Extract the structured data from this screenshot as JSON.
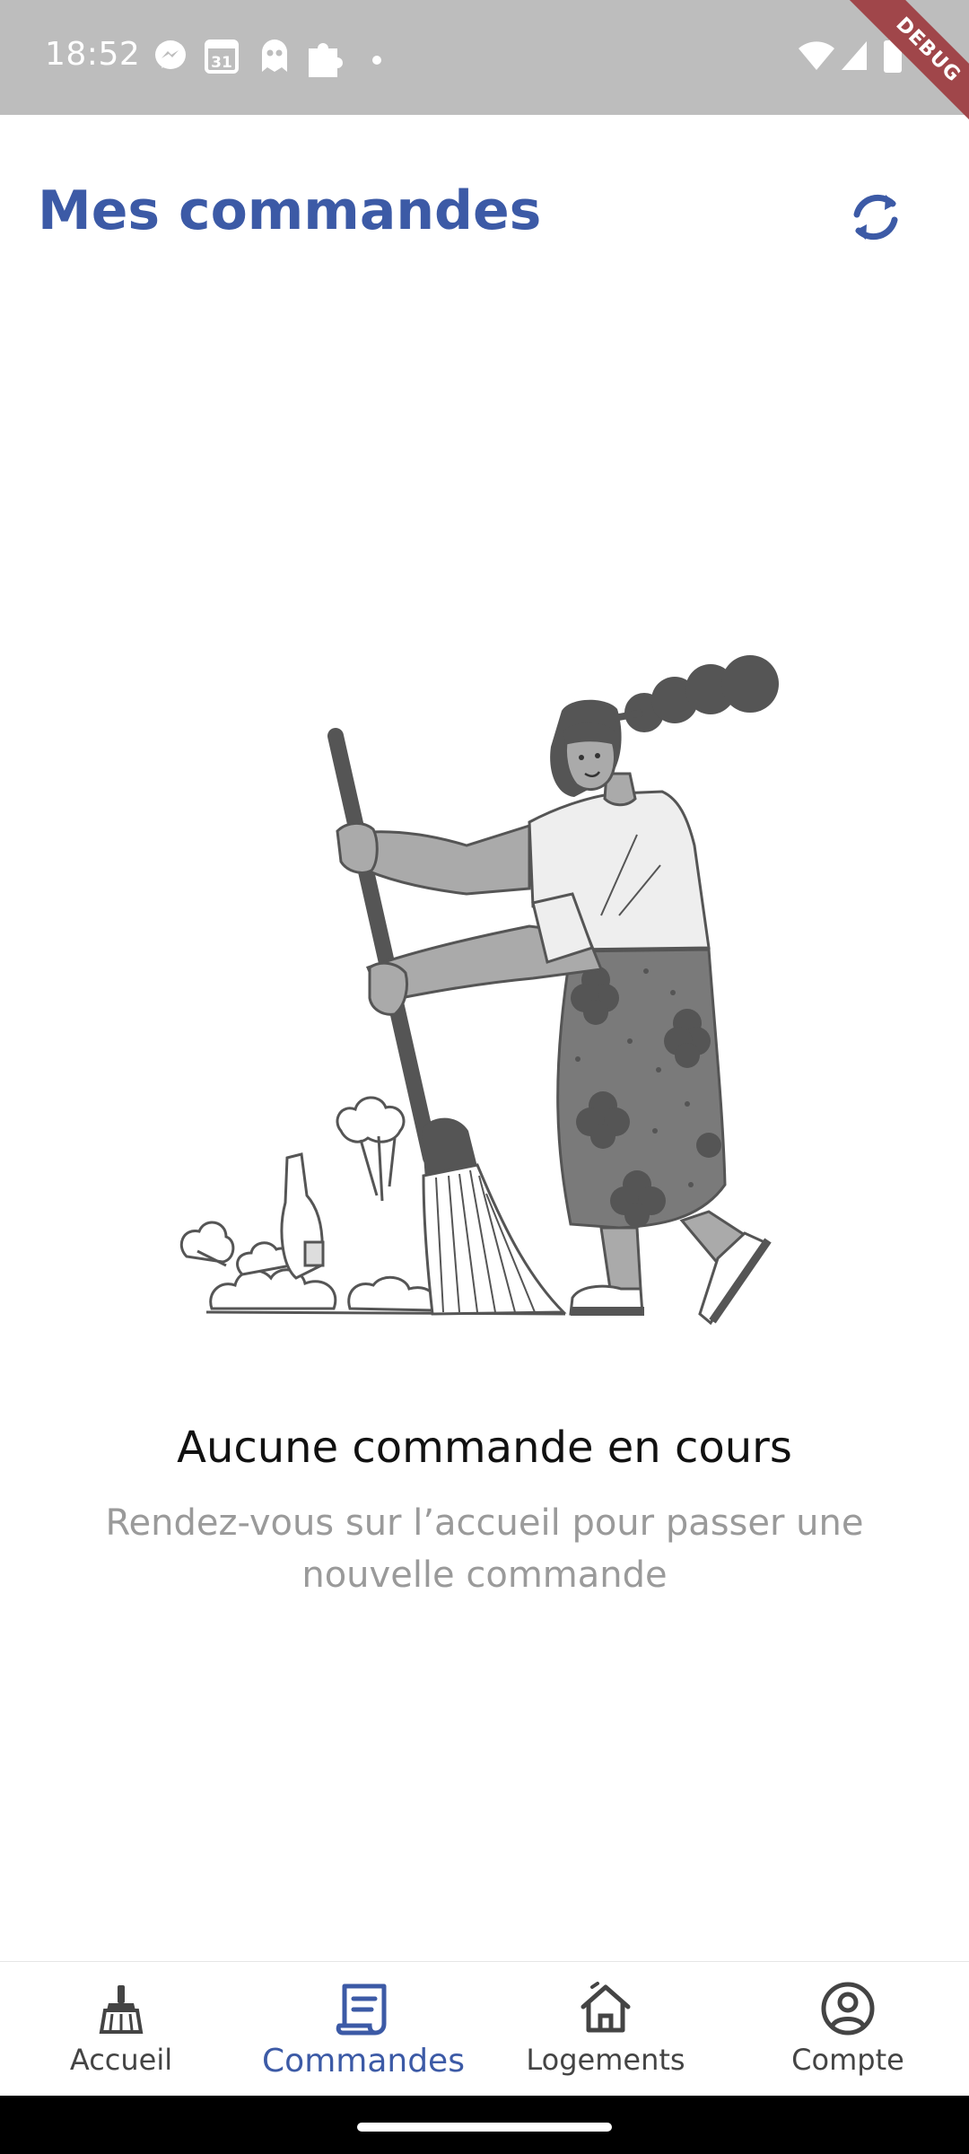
{
  "status_bar": {
    "time": "18:52",
    "icons": [
      "messenger-icon",
      "calendar-icon",
      "ghost-icon",
      "puzzle-icon",
      "dot-icon",
      "wifi-icon",
      "signal-icon",
      "battery-icon"
    ],
    "calendar_day": "31",
    "debug_label": "DEBUG"
  },
  "header": {
    "title": "Mes commandes",
    "refresh_icon": "refresh-icon"
  },
  "empty_state": {
    "illustration": "woman-sweeping-illustration",
    "title": "Aucune commande en cours",
    "subtitle": "Rendez-vous sur l’accueil pour passer une nouvelle commande"
  },
  "bottom_nav": {
    "items": [
      {
        "label": "Accueil",
        "icon": "broom-icon",
        "active": false
      },
      {
        "label": "Commandes",
        "icon": "receipt-icon",
        "active": true
      },
      {
        "label": "Logements",
        "icon": "house-icon",
        "active": false
      },
      {
        "label": "Compte",
        "icon": "account-icon",
        "active": false
      }
    ]
  },
  "colors": {
    "accent": "#3c5aa6",
    "status_bar": "#bdbdbd",
    "inactive": "#444444",
    "subtitle": "#9a9a9a",
    "debug_ribbon": "#a0464a"
  }
}
